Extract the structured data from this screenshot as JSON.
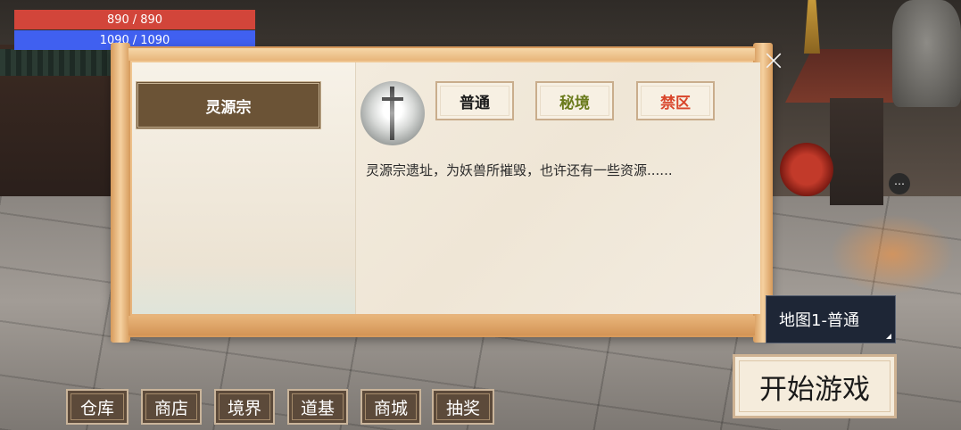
{
  "hud": {
    "hp": {
      "current": "890",
      "max": "890",
      "color": "#d2453a"
    },
    "mp": {
      "current": "1090",
      "max": "1090",
      "color": "#4060f0"
    },
    "separator": "/"
  },
  "dialog": {
    "close_label": "×",
    "location_tab": "灵源宗",
    "tiers": {
      "normal": "普通",
      "secret": "秘境",
      "forbidden": "禁区"
    },
    "description": "灵源宗遗址，为妖兽所摧毁，也许还有一些资源......"
  },
  "map_select": {
    "value": "地图1-普通"
  },
  "start_button": "开始游戏",
  "bottom_nav": [
    "仓库",
    "商店",
    "境界",
    "道基",
    "商城",
    "抽奖"
  ],
  "colors": {
    "tier_secret": "#6a7b1c",
    "tier_forbidden": "#d9452a"
  }
}
